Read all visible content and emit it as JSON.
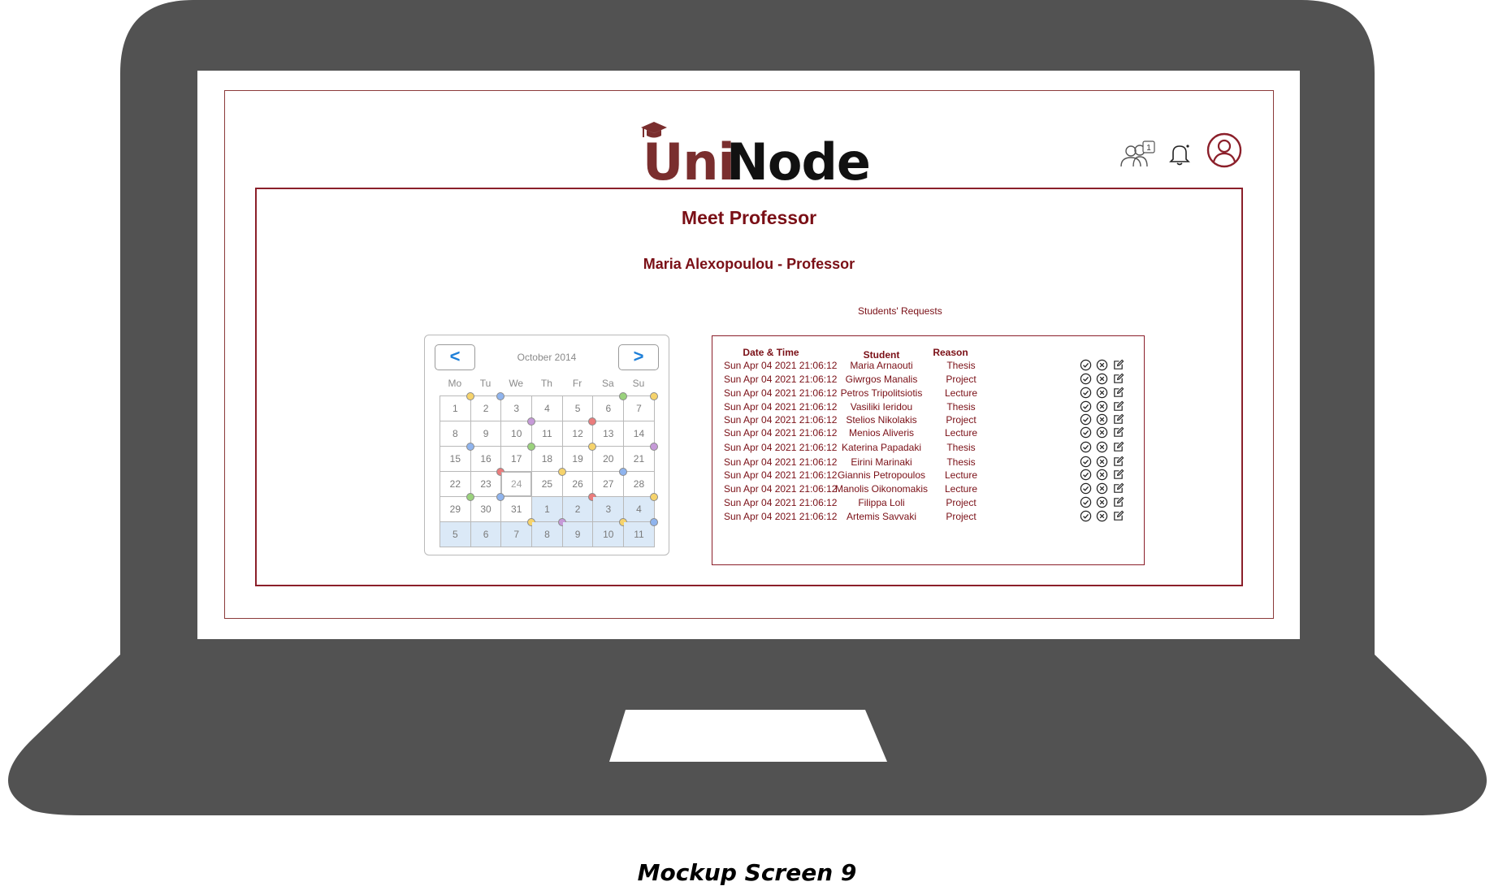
{
  "app": {
    "logo_part1": "Uni",
    "logo_part2": "Node",
    "brand_color": "#7a2e2e",
    "accent_color": "#7a0f16",
    "header_icons": [
      "group-requests-icon",
      "bell-icon",
      "user-profile-icon"
    ],
    "requests_badge": "1"
  },
  "page": {
    "title": "Meet Professor",
    "subtitle": "Maria Alexopoulou - Professor",
    "requests_caption": "Students' Requests"
  },
  "calendar": {
    "prev_label": "<",
    "next_label": ">",
    "month": "October 2014",
    "weekdays": [
      "Mo",
      "Tu",
      "We",
      "Th",
      "Fr",
      "Sa",
      "Su"
    ],
    "days": [
      {
        "d": "1",
        "dot": "#f6d36b"
      },
      {
        "d": "2",
        "dot": "#8fb4ee"
      },
      {
        "d": "3",
        "dot": ""
      },
      {
        "d": "4",
        "dot": ""
      },
      {
        "d": "5",
        "dot": ""
      },
      {
        "d": "6",
        "dot": "#9ad27c"
      },
      {
        "d": "7",
        "dot": "#f6d36b"
      },
      {
        "d": "8",
        "dot": ""
      },
      {
        "d": "9",
        "dot": ""
      },
      {
        "d": "10",
        "dot": "#c69ad8"
      },
      {
        "d": "11",
        "dot": ""
      },
      {
        "d": "12",
        "dot": "#ea7c7c"
      },
      {
        "d": "13",
        "dot": ""
      },
      {
        "d": "14",
        "dot": ""
      },
      {
        "d": "15",
        "dot": "#8fb4ee"
      },
      {
        "d": "16",
        "dot": ""
      },
      {
        "d": "17",
        "dot": "#9ad27c"
      },
      {
        "d": "18",
        "dot": ""
      },
      {
        "d": "19",
        "dot": "#f6d36b"
      },
      {
        "d": "20",
        "dot": ""
      },
      {
        "d": "21",
        "dot": "#c69ad8"
      },
      {
        "d": "22",
        "dot": ""
      },
      {
        "d": "23",
        "dot": "#ea7c7c"
      },
      {
        "d": "24",
        "dot": "",
        "today": true
      },
      {
        "d": "25",
        "dot": "#f6d36b"
      },
      {
        "d": "26",
        "dot": ""
      },
      {
        "d": "27",
        "dot": "#8fb4ee"
      },
      {
        "d": "28",
        "dot": ""
      },
      {
        "d": "29",
        "dot": "#9ad27c"
      },
      {
        "d": "30",
        "dot": "#8fb4ee"
      },
      {
        "d": "31",
        "dot": ""
      },
      {
        "d": "1",
        "dot": "",
        "next": true
      },
      {
        "d": "2",
        "dot": "#ea7c7c",
        "next": true
      },
      {
        "d": "3",
        "dot": "",
        "next": true
      },
      {
        "d": "4",
        "dot": "#f6d36b",
        "next": true
      },
      {
        "d": "5",
        "dot": "",
        "next": true
      },
      {
        "d": "6",
        "dot": "",
        "next": true
      },
      {
        "d": "7",
        "dot": "#f6d36b",
        "next": true
      },
      {
        "d": "8",
        "dot": "#c69ad8",
        "next": true
      },
      {
        "d": "9",
        "dot": "",
        "next": true
      },
      {
        "d": "10",
        "dot": "#f6d36b",
        "next": true
      },
      {
        "d": "11",
        "dot": "#8fb4ee",
        "next": true
      }
    ]
  },
  "requests": {
    "headers": {
      "date": "Date & Time",
      "student": "Student",
      "reason": "Reason"
    },
    "rows": [
      {
        "date": "Sun Apr 04 2021 21:06:12",
        "student": "Maria  Arnaouti",
        "reason": "Thesis"
      },
      {
        "date": "Sun Apr 04 2021 21:06:12",
        "student": "Giwrgos Manalis",
        "reason": "Project"
      },
      {
        "date": "Sun Apr 04 2021 21:06:12",
        "student": "Petros Tripolitsiotis",
        "reason": "Lecture"
      },
      {
        "date": "Sun Apr 04 2021 21:06:12",
        "student": "Vasiliki Ieridou",
        "reason": "Thesis"
      },
      {
        "date": "Sun Apr 04 2021 21:06:12",
        "student": "Stelios Nikolakis",
        "reason": "Project"
      },
      {
        "date": "Sun Apr 04 2021 21:06:12",
        "student": "Menios Aliveris",
        "reason": "Lecture"
      },
      {
        "date": "Sun Apr 04 2021 21:06:12",
        "student": "Katerina Papadaki",
        "reason": "Thesis"
      },
      {
        "date": "Sun Apr 04 2021 21:06:12",
        "student": "Eirini Marinaki",
        "reason": "Thesis"
      },
      {
        "date": "Sun Apr 04 2021 21:06:12",
        "student": "Giannis Petropoulos",
        "reason": "Lecture"
      },
      {
        "date": "Sun Apr 04 2021 21:06:12",
        "student": "Manolis Oikonomakis",
        "reason": "Lecture"
      },
      {
        "date": "Sun Apr 04 2021 21:06:12",
        "student": "Filippa Loli",
        "reason": "Project"
      },
      {
        "date": "Sun Apr 04 2021 21:06:12",
        "student": "Artemis Savvaki",
        "reason": "Project"
      }
    ],
    "action_icons": [
      "accept-check-icon",
      "reject-x-icon",
      "edit-icon"
    ]
  },
  "mockup_caption": "Mockup Screen 9"
}
